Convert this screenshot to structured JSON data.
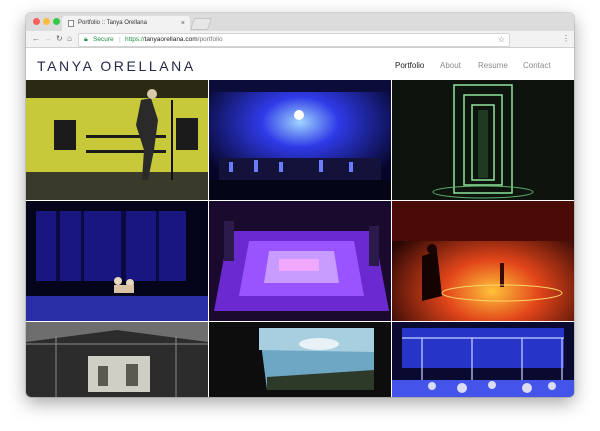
{
  "browser": {
    "tab_title": "Portfolio :: Tanya Orellana",
    "tab_close": "×",
    "secure_label": "Secure",
    "url_protocol": "https://",
    "url_host": "tanyaorellana.com",
    "url_path": "/portfolio"
  },
  "site": {
    "title": "TANYA ORELLANA",
    "nav": [
      {
        "label": "Portfolio",
        "active": true
      },
      {
        "label": "About",
        "active": false
      },
      {
        "label": "Resume",
        "active": false
      },
      {
        "label": "Contact",
        "active": false
      }
    ]
  },
  "gallery": {
    "tiles": [
      {
        "name": "tile-yellow-stage",
        "colors": [
          "#c7c83a",
          "#1b1b1b"
        ]
      },
      {
        "name": "tile-blue-concert",
        "colors": [
          "#1f22c9",
          "#05052a"
        ]
      },
      {
        "name": "tile-green-light-corridor",
        "colors": [
          "#0f1a10",
          "#7fd38a"
        ]
      },
      {
        "name": "tile-blue-forest-stage",
        "colors": [
          "#1a1680",
          "#04041a"
        ]
      },
      {
        "name": "tile-purple-square-floor",
        "colors": [
          "#7a2ee0",
          "#1a0b2e"
        ]
      },
      {
        "name": "tile-red-orange-stage",
        "colors": [
          "#c2320f",
          "#2a0604"
        ]
      },
      {
        "name": "tile-warehouse-projection",
        "colors": [
          "#9a9a9a",
          "#2c2c2c"
        ]
      },
      {
        "name": "tile-sky-projection",
        "colors": [
          "#6ea7c4",
          "#0d0d0d"
        ]
      },
      {
        "name": "tile-blue-scaffold-stage",
        "colors": [
          "#2634c8",
          "#0a0a30"
        ]
      }
    ]
  }
}
